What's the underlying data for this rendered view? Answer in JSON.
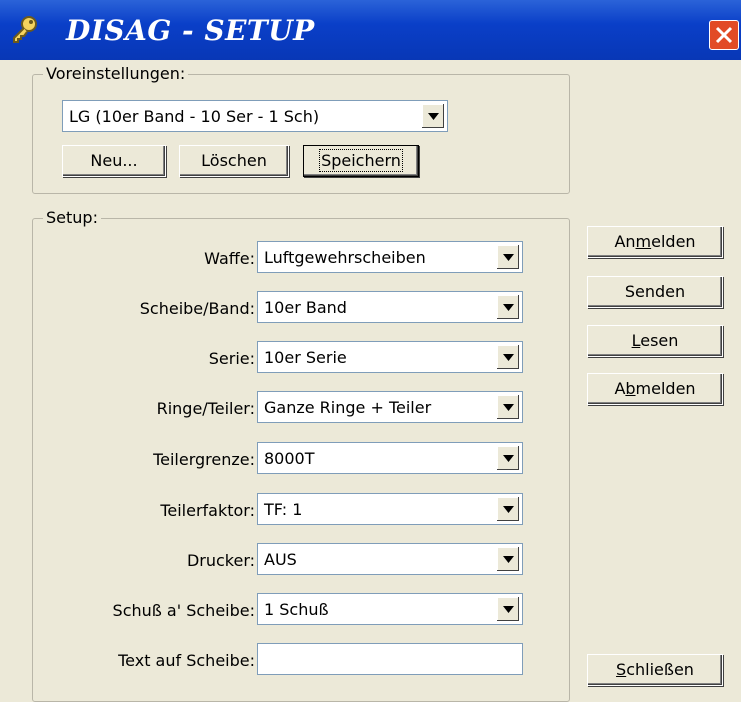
{
  "window": {
    "title": "DISAG - SETUP",
    "icon": "key-icon"
  },
  "presets": {
    "group_label": "Voreinstellungen:",
    "selected": "LG (10er Band - 10 Ser - 1 Sch)",
    "buttons": {
      "new": "Neu...",
      "delete": "Löschen",
      "save": "Speichern"
    }
  },
  "setup": {
    "group_label": "Setup:",
    "fields": [
      {
        "label": "Waffe:",
        "value": "Luftgewehrscheiben"
      },
      {
        "label": "Scheibe/Band:",
        "value": "10er Band"
      },
      {
        "label": "Serie:",
        "value": "10er Serie"
      },
      {
        "label": "Ringe/Teiler:",
        "value": "Ganze Ringe + Teiler"
      },
      {
        "label": "Teilergrenze:",
        "value": "8000T"
      },
      {
        "label": "Teilerfaktor:",
        "value": "TF: 1"
      },
      {
        "label": "Drucker:",
        "value": "AUS"
      },
      {
        "label": "Schuß a' Scheibe:",
        "value": "1 Schuß"
      }
    ],
    "text_field": {
      "label": "Text auf Scheibe:",
      "value": ""
    }
  },
  "side_buttons": {
    "anmelden_pre": "An",
    "anmelden_key": "m",
    "anmelden_post": "elden",
    "senden": "Senden",
    "lesen_key": "L",
    "lesen_post": "esen",
    "abmelden_pre": "A",
    "abmelden_key": "b",
    "abmelden_post": "melden",
    "schliessen_key": "S",
    "schliessen_post": "chließen"
  },
  "colors": {
    "titlebar": "#0a3fc8",
    "window": "#ece9d8",
    "close": "#e24b26"
  }
}
